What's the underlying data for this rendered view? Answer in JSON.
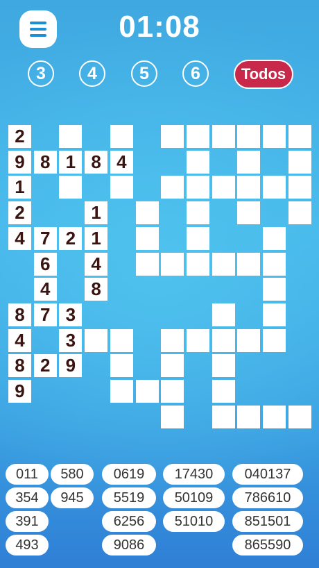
{
  "header": {
    "timer": "01:08"
  },
  "filters": [
    {
      "label": "3"
    },
    {
      "label": "4"
    },
    {
      "label": "5"
    },
    {
      "label": "6"
    },
    {
      "label": "Todos",
      "active": true
    }
  ],
  "accent_color": "#c8284a",
  "grid": {
    "cells": [
      {
        "c": 0,
        "r": 0,
        "v": "2"
      },
      {
        "c": 2,
        "r": 0,
        "v": ""
      },
      {
        "c": 4,
        "r": 0,
        "v": ""
      },
      {
        "c": 6,
        "r": 0,
        "v": ""
      },
      {
        "c": 7,
        "r": 0,
        "v": ""
      },
      {
        "c": 8,
        "r": 0,
        "v": ""
      },
      {
        "c": 9,
        "r": 0,
        "v": ""
      },
      {
        "c": 10,
        "r": 0,
        "v": ""
      },
      {
        "c": 11,
        "r": 0,
        "v": ""
      },
      {
        "c": 0,
        "r": 1,
        "v": "9"
      },
      {
        "c": 1,
        "r": 1,
        "v": "8"
      },
      {
        "c": 2,
        "r": 1,
        "v": "1"
      },
      {
        "c": 3,
        "r": 1,
        "v": "8"
      },
      {
        "c": 4,
        "r": 1,
        "v": "4"
      },
      {
        "c": 7,
        "r": 1,
        "v": ""
      },
      {
        "c": 9,
        "r": 1,
        "v": ""
      },
      {
        "c": 11,
        "r": 1,
        "v": ""
      },
      {
        "c": 0,
        "r": 2,
        "v": "1"
      },
      {
        "c": 2,
        "r": 2,
        "v": ""
      },
      {
        "c": 4,
        "r": 2,
        "v": ""
      },
      {
        "c": 6,
        "r": 2,
        "v": ""
      },
      {
        "c": 7,
        "r": 2,
        "v": ""
      },
      {
        "c": 8,
        "r": 2,
        "v": ""
      },
      {
        "c": 9,
        "r": 2,
        "v": ""
      },
      {
        "c": 10,
        "r": 2,
        "v": ""
      },
      {
        "c": 11,
        "r": 2,
        "v": ""
      },
      {
        "c": 0,
        "r": 3,
        "v": "2"
      },
      {
        "c": 3,
        "r": 3,
        "v": "1"
      },
      {
        "c": 5,
        "r": 3,
        "v": ""
      },
      {
        "c": 7,
        "r": 3,
        "v": ""
      },
      {
        "c": 9,
        "r": 3,
        "v": ""
      },
      {
        "c": 11,
        "r": 3,
        "v": ""
      },
      {
        "c": 0,
        "r": 4,
        "v": "4"
      },
      {
        "c": 1,
        "r": 4,
        "v": "7"
      },
      {
        "c": 2,
        "r": 4,
        "v": "2"
      },
      {
        "c": 3,
        "r": 4,
        "v": "1"
      },
      {
        "c": 5,
        "r": 4,
        "v": ""
      },
      {
        "c": 7,
        "r": 4,
        "v": ""
      },
      {
        "c": 10,
        "r": 4,
        "v": ""
      },
      {
        "c": 1,
        "r": 5,
        "v": "6"
      },
      {
        "c": 3,
        "r": 5,
        "v": "4"
      },
      {
        "c": 5,
        "r": 5,
        "v": ""
      },
      {
        "c": 6,
        "r": 5,
        "v": ""
      },
      {
        "c": 7,
        "r": 5,
        "v": ""
      },
      {
        "c": 8,
        "r": 5,
        "v": ""
      },
      {
        "c": 9,
        "r": 5,
        "v": ""
      },
      {
        "c": 10,
        "r": 5,
        "v": ""
      },
      {
        "c": 1,
        "r": 6,
        "v": "4"
      },
      {
        "c": 3,
        "r": 6,
        "v": "8"
      },
      {
        "c": 10,
        "r": 6,
        "v": ""
      },
      {
        "c": 0,
        "r": 7,
        "v": "8"
      },
      {
        "c": 1,
        "r": 7,
        "v": "7"
      },
      {
        "c": 2,
        "r": 7,
        "v": "3"
      },
      {
        "c": 8,
        "r": 7,
        "v": ""
      },
      {
        "c": 10,
        "r": 7,
        "v": ""
      },
      {
        "c": 0,
        "r": 8,
        "v": "4"
      },
      {
        "c": 2,
        "r": 8,
        "v": "3"
      },
      {
        "c": 3,
        "r": 8,
        "v": ""
      },
      {
        "c": 4,
        "r": 8,
        "v": ""
      },
      {
        "c": 6,
        "r": 8,
        "v": ""
      },
      {
        "c": 7,
        "r": 8,
        "v": ""
      },
      {
        "c": 8,
        "r": 8,
        "v": ""
      },
      {
        "c": 9,
        "r": 8,
        "v": ""
      },
      {
        "c": 10,
        "r": 8,
        "v": ""
      },
      {
        "c": 0,
        "r": 9,
        "v": "8"
      },
      {
        "c": 1,
        "r": 9,
        "v": "2"
      },
      {
        "c": 2,
        "r": 9,
        "v": "9"
      },
      {
        "c": 4,
        "r": 9,
        "v": ""
      },
      {
        "c": 6,
        "r": 9,
        "v": ""
      },
      {
        "c": 8,
        "r": 9,
        "v": ""
      },
      {
        "c": 0,
        "r": 10,
        "v": "9"
      },
      {
        "c": 4,
        "r": 10,
        "v": ""
      },
      {
        "c": 5,
        "r": 10,
        "v": ""
      },
      {
        "c": 6,
        "r": 10,
        "v": ""
      },
      {
        "c": 8,
        "r": 10,
        "v": ""
      },
      {
        "c": 6,
        "r": 11,
        "v": ""
      },
      {
        "c": 8,
        "r": 11,
        "v": ""
      },
      {
        "c": 9,
        "r": 11,
        "v": ""
      },
      {
        "c": 10,
        "r": 11,
        "v": ""
      },
      {
        "c": 11,
        "r": 11,
        "v": ""
      }
    ]
  },
  "word_bank": [
    {
      "col": 0,
      "row": 0,
      "text": "011"
    },
    {
      "col": 0,
      "row": 1,
      "text": "354"
    },
    {
      "col": 0,
      "row": 2,
      "text": "391"
    },
    {
      "col": 0,
      "row": 3,
      "text": "493"
    },
    {
      "col": 1,
      "row": 0,
      "text": "580"
    },
    {
      "col": 1,
      "row": 1,
      "text": "945"
    },
    {
      "col": 2,
      "row": 0,
      "text": "0619"
    },
    {
      "col": 2,
      "row": 1,
      "text": "5519"
    },
    {
      "col": 2,
      "row": 2,
      "text": "6256"
    },
    {
      "col": 2,
      "row": 3,
      "text": "9086"
    },
    {
      "col": 3,
      "row": 0,
      "text": "17430"
    },
    {
      "col": 3,
      "row": 1,
      "text": "50109"
    },
    {
      "col": 3,
      "row": 2,
      "text": "51010"
    },
    {
      "col": 4,
      "row": 0,
      "text": "040137"
    },
    {
      "col": 4,
      "row": 1,
      "text": "786610"
    },
    {
      "col": 4,
      "row": 2,
      "text": "851501"
    },
    {
      "col": 4,
      "row": 3,
      "text": "865590"
    }
  ]
}
